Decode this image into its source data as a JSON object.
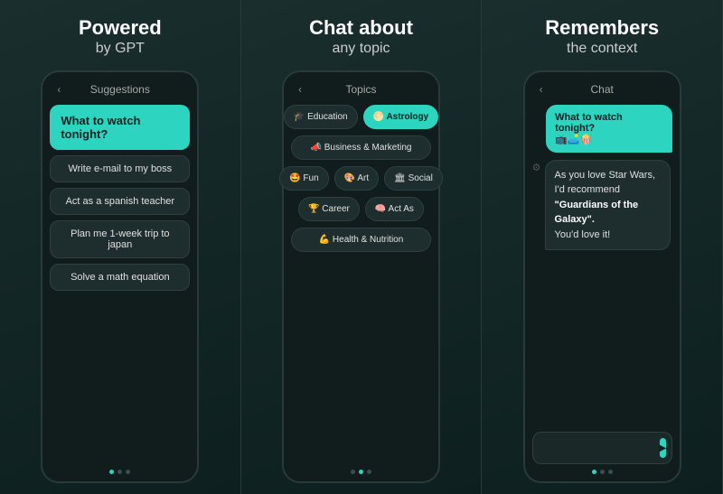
{
  "panels": [
    {
      "id": "panel-gpt",
      "title": "Powered",
      "subtitle": "by GPT",
      "phone_bar_title": "Suggestions",
      "highlight_suggestion": "What to watch tonight?",
      "suggestions": [
        "Write e-mail to my boss",
        "Act as a spanish teacher",
        "Plan me 1-week trip to japan",
        "Solve a math equation"
      ],
      "active_dot": 0,
      "dots": 3
    },
    {
      "id": "panel-topics",
      "title": "Chat about",
      "subtitle": "any topic",
      "phone_bar_title": "Topics",
      "topic_rows": [
        [
          {
            "label": "🎓 Education",
            "active": false
          },
          {
            "label": "🌕 Astrology",
            "active": true
          }
        ],
        [
          {
            "label": "📣 Business & Marketing",
            "active": false,
            "wide": true
          }
        ],
        [
          {
            "label": "🤩 Fun",
            "active": false
          },
          {
            "label": "🎨 Art",
            "active": false
          },
          {
            "label": "🏛 Social",
            "active": false
          }
        ],
        [
          {
            "label": "🏆 Career",
            "active": false
          },
          {
            "label": "🧠 Act As",
            "active": false
          }
        ],
        [
          {
            "label": "💪 Health & Nutrition",
            "active": false,
            "wide": true
          }
        ]
      ],
      "active_dot": 1,
      "dots": 3
    },
    {
      "id": "panel-chat",
      "title": "Remembers",
      "subtitle": "the context",
      "phone_bar_title": "Chat",
      "chat_messages": [
        {
          "type": "user",
          "text": "What to watch tonight?\n📺🛋️🍿"
        },
        {
          "type": "ai",
          "text_before": "As you love Star Wars, I'd recommend ",
          "text_bold": "\"Guardians of the Galaxy\".",
          "text_after": "\nYou'd love it!"
        }
      ],
      "chat_input_placeholder": "",
      "send_icon": "▶",
      "active_dot": 0,
      "dots": 3
    }
  ]
}
